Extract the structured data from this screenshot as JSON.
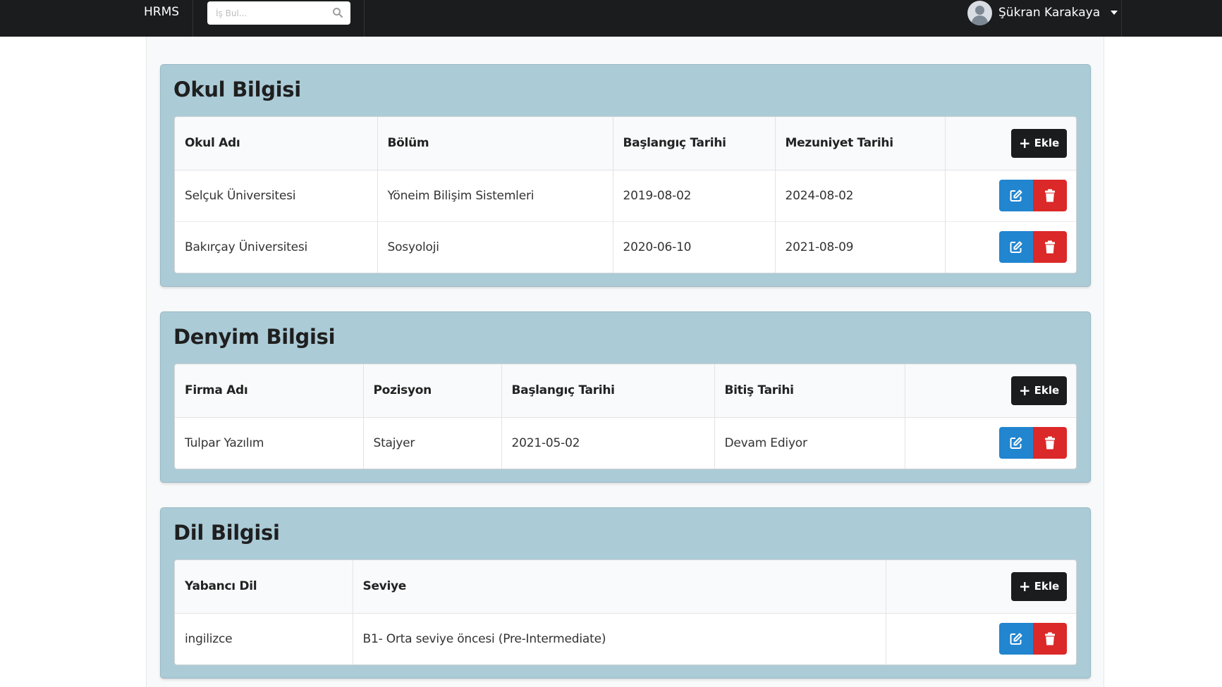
{
  "navbar": {
    "brand": "HRMS",
    "search_placeholder": "İş Bul...",
    "user_name": "Şükran Karakaya"
  },
  "colors": {
    "navbar_bg": "#1b1c1d",
    "section_bg": "#abcbd7",
    "edit_button": "#2185d0",
    "delete_button": "#db2828",
    "add_button": "#1b1c1d"
  },
  "icons": {
    "search": "search-icon",
    "user_menu": "dropdown-caret-icon",
    "add": "plus-icon",
    "edit": "edit-icon",
    "delete": "trash-icon"
  },
  "add_label": "Ekle",
  "sections": {
    "education": {
      "title": "Okul Bilgisi",
      "headers": [
        "Okul Adı",
        "Bölüm",
        "Başlangıç Tarihi",
        "Mezuniyet Tarihi"
      ],
      "rows": [
        [
          "Selçuk Üniversitesi",
          "Yöneim Bilişim Sistemleri",
          "2019-08-02",
          "2024-08-02"
        ],
        [
          "Bakırçay Üniversitesi",
          "Sosyoloji",
          "2020-06-10",
          "2021-08-09"
        ]
      ]
    },
    "experience": {
      "title": "Denyim Bilgisi",
      "headers": [
        "Firma Adı",
        "Pozisyon",
        "Başlangıç Tarihi",
        "Bitiş Tarihi"
      ],
      "rows": [
        [
          "Tulpar Yazılım",
          "Stajyer",
          "2021-05-02",
          "Devam Ediyor"
        ]
      ]
    },
    "language": {
      "title": "Dil Bilgisi",
      "headers": [
        "Yabancı Dil",
        "Seviye"
      ],
      "rows": [
        [
          "ingilizce",
          "B1- Orta seviye öncesi (Pre-Intermediate)"
        ]
      ]
    }
  }
}
